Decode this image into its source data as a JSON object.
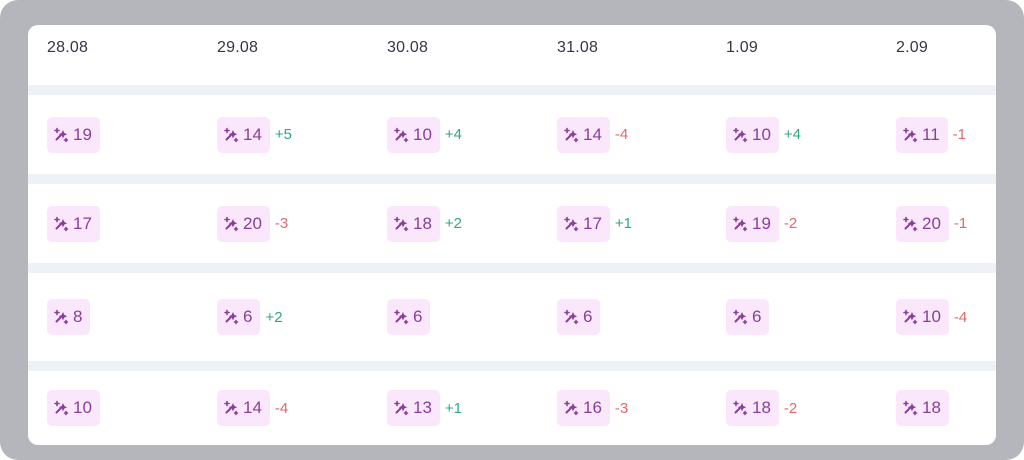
{
  "colors": {
    "chip_bg": "#fae7fb",
    "chip_text": "#8a3e9c",
    "positive": "#2ea880",
    "negative": "#e5686a"
  },
  "icon": "sparkle-magic-icon",
  "dates": [
    "28.08",
    "29.08",
    "30.08",
    "31.08",
    "1.09",
    "2.09"
  ],
  "rows": [
    {
      "cells": [
        {
          "value": "19",
          "delta": ""
        },
        {
          "value": "14",
          "delta": "+5"
        },
        {
          "value": "10",
          "delta": "+4"
        },
        {
          "value": "14",
          "delta": "-4"
        },
        {
          "value": "10",
          "delta": "+4"
        },
        {
          "value": "11",
          "delta": "-1"
        }
      ]
    },
    {
      "cells": [
        {
          "value": "17",
          "delta": ""
        },
        {
          "value": "20",
          "delta": "-3"
        },
        {
          "value": "18",
          "delta": "+2"
        },
        {
          "value": "17",
          "delta": "+1"
        },
        {
          "value": "19",
          "delta": "-2"
        },
        {
          "value": "20",
          "delta": "-1"
        }
      ]
    },
    {
      "cells": [
        {
          "value": "8",
          "delta": ""
        },
        {
          "value": "6",
          "delta": "+2"
        },
        {
          "value": "6",
          "delta": ""
        },
        {
          "value": "6",
          "delta": ""
        },
        {
          "value": "6",
          "delta": ""
        },
        {
          "value": "10",
          "delta": "-4"
        }
      ]
    },
    {
      "cells": [
        {
          "value": "10",
          "delta": ""
        },
        {
          "value": "14",
          "delta": "-4"
        },
        {
          "value": "13",
          "delta": "+1"
        },
        {
          "value": "16",
          "delta": "-3"
        },
        {
          "value": "18",
          "delta": "-2"
        },
        {
          "value": "18",
          "delta": ""
        }
      ]
    }
  ]
}
